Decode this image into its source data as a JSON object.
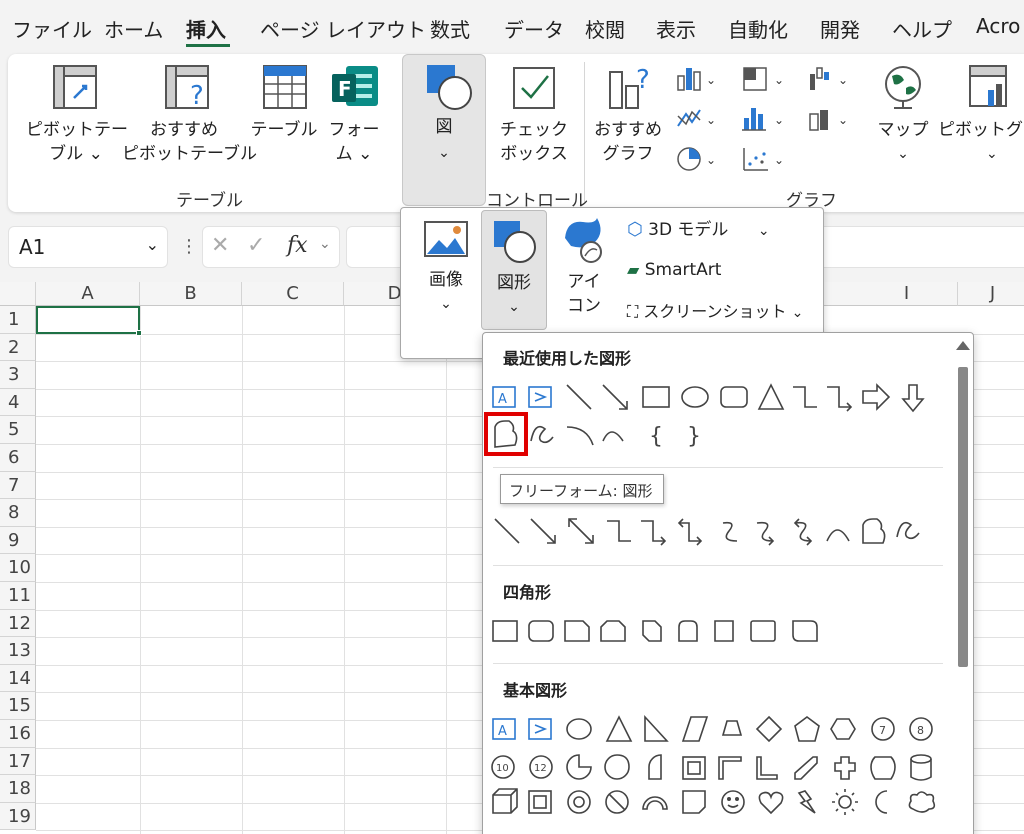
{
  "menu": {
    "tabs": [
      "ファイル",
      "ホーム",
      "挿入",
      "ページ レイアウト",
      "数式",
      "データ",
      "校閲",
      "表示",
      "自動化",
      "開発",
      "ヘルプ",
      "Acro"
    ],
    "active_tab": "挿入"
  },
  "ribbon": {
    "pivot_line1": "ピボットテー",
    "pivot_line2": "ブル ⌄",
    "recommended_line1": "おすすめ",
    "recommended_line2": "ピボットテーブル",
    "table": "テーブル",
    "forms_line1": "フォー",
    "forms_line2": "ム ⌄",
    "group_table": "テーブル",
    "figure": "図",
    "checkbox_line1": "チェック",
    "checkbox_line2": "ボックス",
    "group_control": "コントロール",
    "rec_chart_line1": "おすすめ",
    "rec_chart_line2": "グラフ",
    "maps": "マップ",
    "pivot_chart": "ピボットグラ",
    "group_chart": "グラフ"
  },
  "formula_bar": {
    "name_box": "A1",
    "fx": "fx"
  },
  "grid": {
    "columns": [
      "A",
      "B",
      "C",
      "D",
      "I",
      "J"
    ],
    "rows": [
      "1",
      "2",
      "3",
      "4",
      "5",
      "6",
      "7",
      "8",
      "9",
      "10",
      "11",
      "12",
      "13",
      "14",
      "15",
      "16",
      "17",
      "18",
      "19"
    ]
  },
  "illustrations": {
    "image": "画像",
    "shapes": "図形",
    "icons_line1": "アイ",
    "icons_line2": "コン",
    "model_3d": "3D モデル",
    "smartart": "SmartArt",
    "screenshot": "スクリーンショット"
  },
  "gallery": {
    "recent": "最近使用した図形",
    "rectangles": "四角形",
    "basic": "基本図形",
    "tooltip": "フリーフォーム: 図形"
  },
  "colors": {
    "accent_green": "#1e7145",
    "highlight_red": "#e00000",
    "icon_blue": "#2b78d0"
  }
}
